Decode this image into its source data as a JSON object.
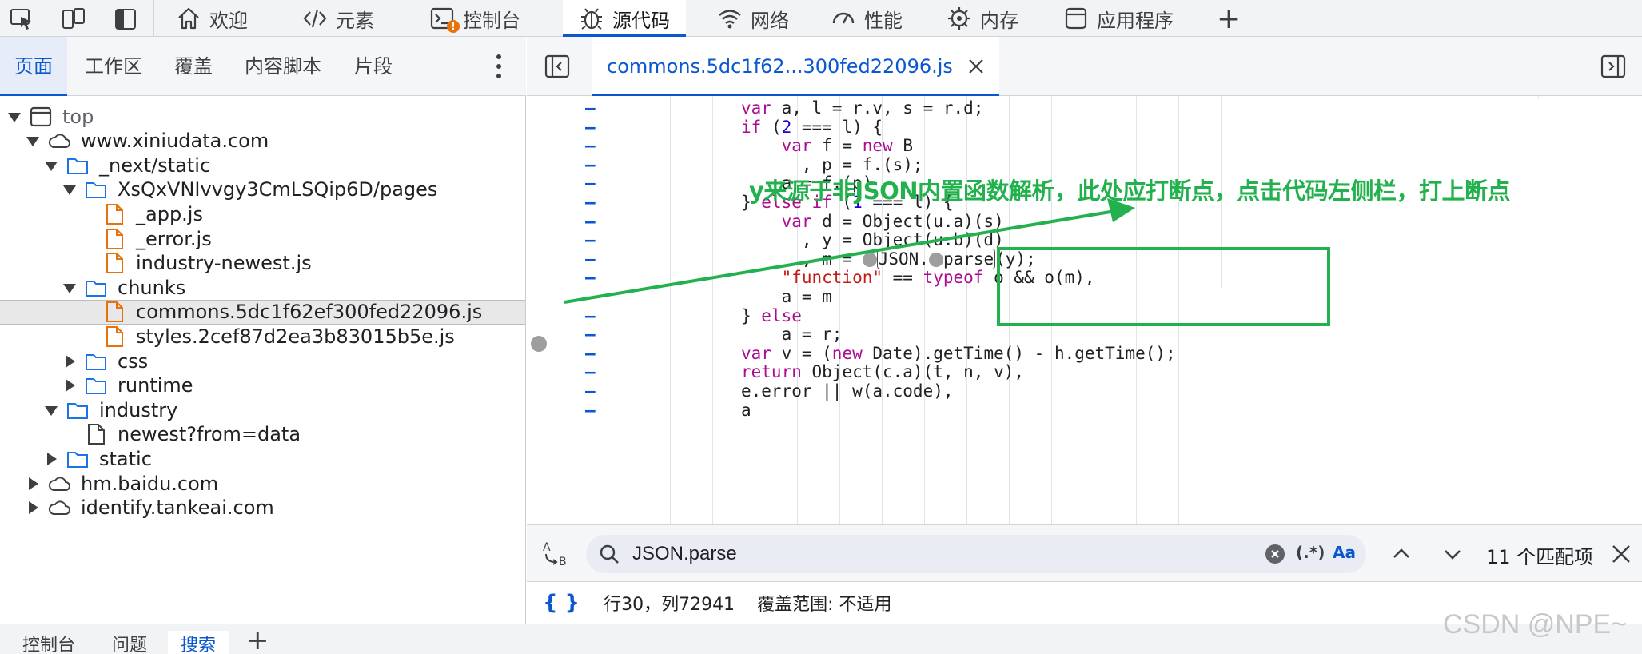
{
  "toolbar": {
    "tabs": [
      {
        "label": "欢迎",
        "icon": "home-icon"
      },
      {
        "label": "元素",
        "icon": "code-tag-icon"
      },
      {
        "label": "控制台",
        "icon": "console-icon"
      },
      {
        "label": "源代码",
        "icon": "bug-icon"
      },
      {
        "label": "网络",
        "icon": "wifi-icon"
      },
      {
        "label": "性能",
        "icon": "gauge-icon"
      },
      {
        "label": "内存",
        "icon": "chip-icon"
      },
      {
        "label": "应用程序",
        "icon": "app-icon"
      }
    ],
    "active_tab": "源代码",
    "add_label": "+"
  },
  "navigator": {
    "tabs": [
      "页面",
      "工作区",
      "覆盖",
      "内容脚本",
      "片段"
    ],
    "active_tab": "页面",
    "tree": [
      {
        "label": "top",
        "type": "frame",
        "twist": "open",
        "depth": 0
      },
      {
        "label": "www.xiniudata.com",
        "type": "cloud",
        "twist": "open",
        "depth": 1
      },
      {
        "label": "_next/static",
        "type": "folder",
        "twist": "open",
        "depth": 2
      },
      {
        "label": "XsQxVNIvvgy3CmLSQip6D/pages",
        "type": "folder",
        "twist": "open",
        "depth": 3
      },
      {
        "label": "_app.js",
        "type": "file-js",
        "twist": "none",
        "depth": 4
      },
      {
        "label": "_error.js",
        "type": "file-js",
        "twist": "none",
        "depth": 4
      },
      {
        "label": "industry-newest.js",
        "type": "file-js",
        "twist": "none",
        "depth": 4
      },
      {
        "label": "chunks",
        "type": "folder",
        "twist": "open",
        "depth": 3
      },
      {
        "label": "commons.5dc1f62ef300fed22096.js",
        "type": "file-js",
        "twist": "none",
        "depth": 4,
        "selected": true
      },
      {
        "label": "styles.2cef87d2ea3b83015b5e.js",
        "type": "file-js",
        "twist": "none",
        "depth": 4
      },
      {
        "label": "css",
        "type": "folder",
        "twist": "closed",
        "depth": 3
      },
      {
        "label": "runtime",
        "type": "folder",
        "twist": "closed",
        "depth": 3
      },
      {
        "label": "industry",
        "type": "folder",
        "twist": "open",
        "depth": 2
      },
      {
        "label": "newest?from=data",
        "type": "file",
        "twist": "none",
        "depth": 3
      },
      {
        "label": "static",
        "type": "folder",
        "twist": "closed",
        "depth": 2
      },
      {
        "label": "hm.baidu.com",
        "type": "cloud",
        "twist": "closed",
        "depth": 1
      },
      {
        "label": "identify.tankeai.com",
        "type": "cloud",
        "twist": "closed",
        "depth": 1
      }
    ]
  },
  "editor": {
    "file_tab": "commons.5dc1f62...300fed22096.js",
    "code_lines": [
      "var a, l = r.v, s = r.d;",
      "if (2 === l) {",
      "    var f = new B",
      "      , p = f.d1(s);",
      "    a = f.d2(p)",
      "} else if (1 === l) {",
      "    var d = Object(u.a)(s)",
      "      , y = Object(u.b)(d)",
      "      , m = JSON.parse(y);",
      "    \"function\" == typeof o && o(m),",
      "    a = m",
      "} else",
      "    a = r;",
      "var v = (new Date).getTime() - h.getTime();",
      "return Object(c.a)(t, n, v),",
      "e.error || w(a.code),",
      "a"
    ]
  },
  "search": {
    "query": "JSON.parse",
    "regex_label": "(.*)",
    "case_label": "Aa",
    "match_count": "11 个匹配项"
  },
  "status": {
    "braces": "{ }",
    "position": "行30，列72941",
    "coverage": "覆盖范围: 不适用"
  },
  "drawer": {
    "tabs": [
      "控制台",
      "问题",
      "搜索"
    ],
    "active_tab": "搜索",
    "add_label": "+"
  },
  "annotation": {
    "text": "y来源于非JSON内置函数解析，此处应打断点，点击代码左侧栏，打上断点",
    "color": "#22b14c"
  },
  "watermark": "CSDN @NPE~",
  "colors": {
    "accent": "#0b57d0",
    "keyword": "#aa0d91",
    "number": "#1c00cf",
    "string": "#c41a16",
    "annotation": "#22b14c"
  }
}
